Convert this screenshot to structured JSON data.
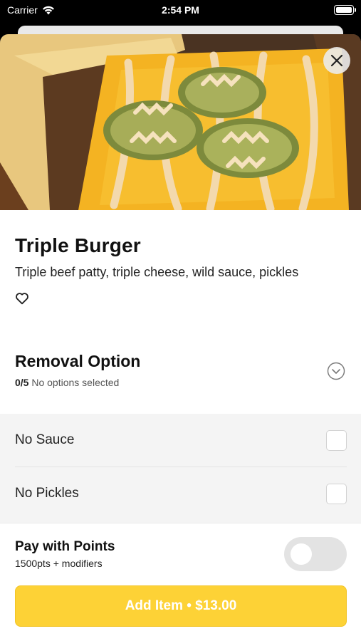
{
  "status_bar": {
    "carrier": "Carrier",
    "time": "2:54 PM"
  },
  "item": {
    "title": "Triple Burger",
    "description": "Triple beef patty, triple cheese, wild sauce, pickles"
  },
  "removal_section": {
    "title": "Removal Option",
    "count": "0/5",
    "status": "No options selected",
    "options": [
      {
        "label": "No Sauce"
      },
      {
        "label": "No Pickles"
      }
    ]
  },
  "points": {
    "title": "Pay with Points",
    "subtitle": "1500pts + modifiers",
    "enabled": false
  },
  "add_button": {
    "label": "Add Item • $13.00"
  },
  "colors": {
    "accent": "#fdd236",
    "toggle_off": "#e3e3e3"
  }
}
